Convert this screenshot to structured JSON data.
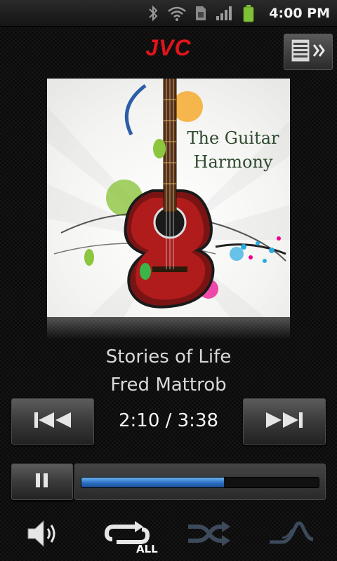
{
  "status_bar": {
    "time": "4:00 PM",
    "icons": [
      "bluetooth-icon",
      "wifi-icon",
      "sim-icon",
      "signal-icon",
      "battery-icon"
    ]
  },
  "header": {
    "brand": "JVC",
    "brand_color": "#e0141c",
    "menu_icon": "playlist-icon"
  },
  "album": {
    "title": "The Guitar Harmony"
  },
  "track": {
    "title": "Stories of Life",
    "artist": "Fred Mattrob",
    "elapsed_total": "2:10 / 3:38",
    "progress": 0.6
  },
  "controls": {
    "prev_icon": "skip-previous-icon",
    "next_icon": "skip-next-icon",
    "pause_icon": "pause-icon",
    "volume_icon": "volume-icon",
    "repeat_icon": "repeat-icon",
    "repeat_mode": "ALL",
    "shuffle_icon": "shuffle-icon",
    "eq_icon": "equalizer-icon"
  }
}
